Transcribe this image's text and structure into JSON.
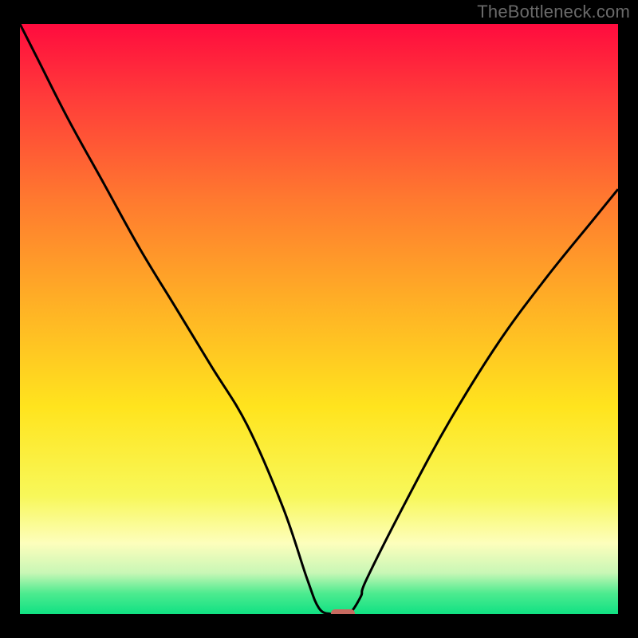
{
  "branding": {
    "watermark": "TheBottleneck.com"
  },
  "chart_data": {
    "type": "line",
    "title": "",
    "xlabel": "",
    "ylabel": "",
    "xlim": [
      0,
      100
    ],
    "ylim": [
      0,
      100
    ],
    "grid": false,
    "legend": false,
    "background_gradient": {
      "stops": [
        {
          "offset": 0.0,
          "color": "#ff0b3e"
        },
        {
          "offset": 0.12,
          "color": "#ff3a3a"
        },
        {
          "offset": 0.3,
          "color": "#ff7a2f"
        },
        {
          "offset": 0.48,
          "color": "#ffb225"
        },
        {
          "offset": 0.65,
          "color": "#ffe41e"
        },
        {
          "offset": 0.8,
          "color": "#f8f85a"
        },
        {
          "offset": 0.88,
          "color": "#fdfebc"
        },
        {
          "offset": 0.93,
          "color": "#c9f7b6"
        },
        {
          "offset": 0.965,
          "color": "#4deb8f"
        },
        {
          "offset": 1.0,
          "color": "#10e183"
        }
      ]
    },
    "series": [
      {
        "name": "bottleneck-curve",
        "color": "#000000",
        "x": [
          0,
          3,
          8,
          14,
          20,
          26,
          32,
          38,
          44,
          48,
          50,
          52,
          53,
          55,
          57,
          58,
          65,
          72,
          80,
          88,
          96,
          100
        ],
        "y": [
          100,
          94,
          84,
          73,
          62,
          52,
          42,
          32,
          18,
          6,
          1,
          0,
          0,
          0,
          3,
          6,
          20,
          33,
          46,
          57,
          67,
          72
        ]
      },
      {
        "name": "minimum-marker",
        "type": "marker",
        "color": "#c86a60",
        "x_range": [
          52,
          56
        ],
        "y": 0
      }
    ],
    "annotations": []
  }
}
